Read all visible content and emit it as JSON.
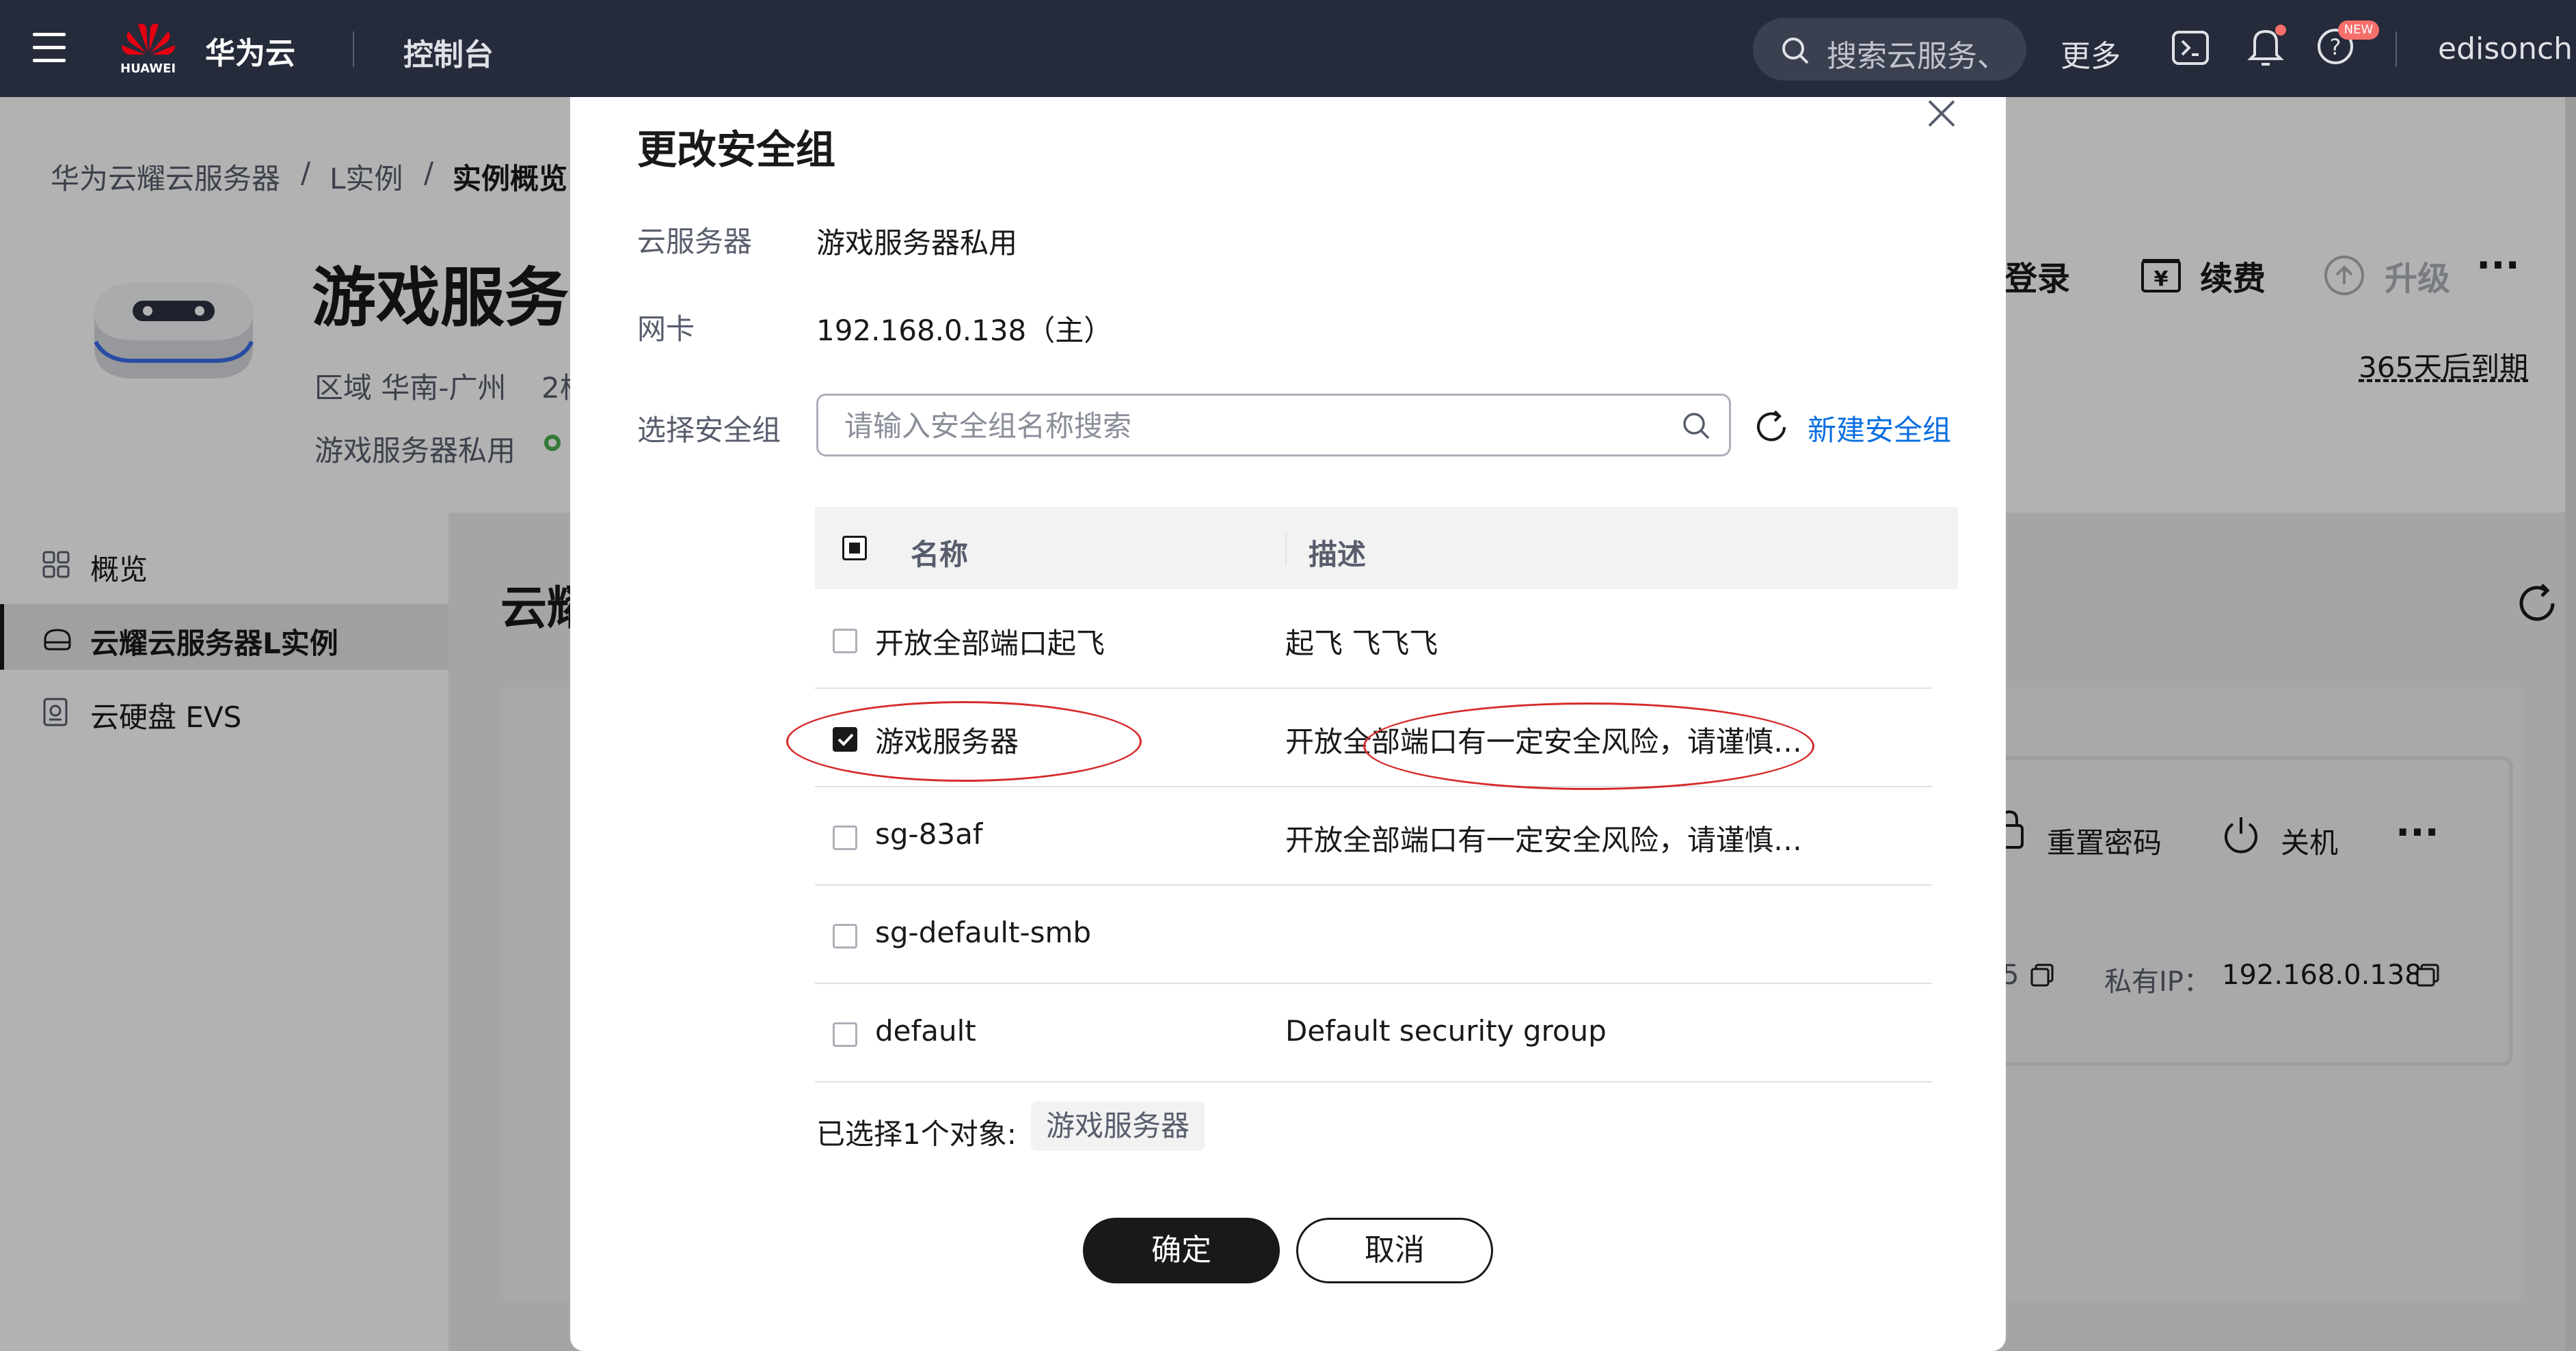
{
  "topbar": {
    "brand": "华为云",
    "logo_text": "HUAWEI",
    "console": "控制台",
    "search_placeholder": "搜索云服务、",
    "more": "更多",
    "new_badge": "NEW",
    "user": "edisonchoi"
  },
  "breadcrumb": {
    "items": [
      "华为云耀云服务器",
      "L实例",
      "实例概览"
    ]
  },
  "instance": {
    "title": "游戏服务",
    "region": "区域 华南-广州",
    "spec_prefix": "2核",
    "name": "游戏服务器私用",
    "actions": {
      "login": "登录",
      "renew": "续费",
      "upgrade": "升级"
    },
    "expire": "365天后到期"
  },
  "sidebar": {
    "items": [
      {
        "label": "概览"
      },
      {
        "label": "云耀云服务器L实例"
      },
      {
        "label": "云硬盘 EVS"
      }
    ]
  },
  "content": {
    "section_title": "云耀",
    "actions": {
      "reset_password": "重置密码",
      "shutdown": "关机"
    },
    "public_ip_tail": "5",
    "private_ip_label": "私有IP：",
    "private_ip": "192.168.0.138"
  },
  "dialog": {
    "title": "更改安全组",
    "server_label": "云服务器",
    "server_value": "游戏服务器私用",
    "nic_label": "网卡",
    "nic_value": "192.168.0.138（主）",
    "select_label": "选择安全组",
    "search_placeholder": "请输入安全组名称搜索",
    "create_link": "新建安全组",
    "table": {
      "headers": {
        "name": "名称",
        "desc": "描述"
      },
      "rows": [
        {
          "name": "开放全部端口起飞",
          "desc": "起飞 飞飞飞",
          "checked": false
        },
        {
          "name": "游戏服务器",
          "desc": "开放全部端口有一定安全风险，请谨慎…",
          "checked": true
        },
        {
          "name": "sg-83af",
          "desc": "开放全部端口有一定安全风险，请谨慎…",
          "checked": false
        },
        {
          "name": "sg-default-smb",
          "desc": "",
          "checked": false
        },
        {
          "name": "default",
          "desc": "Default security group",
          "checked": false
        }
      ]
    },
    "selected_summary": "已选择1个对象:",
    "selected_tag": "游戏服务器",
    "confirm": "确定",
    "cancel": "取消"
  },
  "colors": {
    "topbar": "#252b3a",
    "link": "#0a6ee1",
    "annotation": "#d62a2a",
    "online": "#4caf50"
  }
}
